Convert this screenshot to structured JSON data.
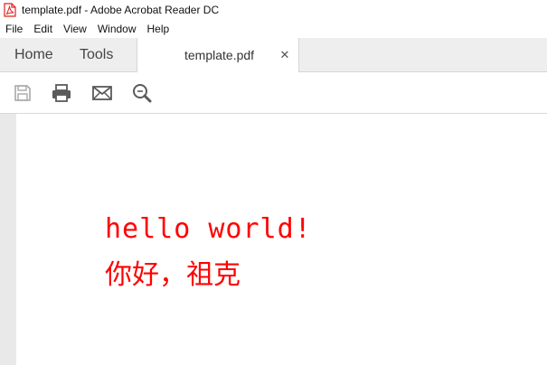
{
  "window": {
    "title": "template.pdf - Adobe Acrobat Reader DC",
    "app_icon": "acrobat-pdf-icon"
  },
  "menu": {
    "items": [
      "File",
      "Edit",
      "View",
      "Window",
      "Help"
    ]
  },
  "tabs": {
    "home_label": "Home",
    "tools_label": "Tools",
    "document_label": "template.pdf",
    "close_glyph": "✕"
  },
  "toolbar": {
    "buttons": [
      {
        "icon": "save-icon"
      },
      {
        "icon": "print-icon"
      },
      {
        "icon": "email-icon"
      },
      {
        "icon": "zoom-search-icon"
      }
    ]
  },
  "document": {
    "line1": "hello world!",
    "line2": "你好，祖克",
    "text_color": "#ff0000"
  },
  "colors": {
    "accent_red": "#e0201b",
    "tab_bar_bg": "#eeeeee",
    "icon_gray": "#5a5a5a"
  }
}
